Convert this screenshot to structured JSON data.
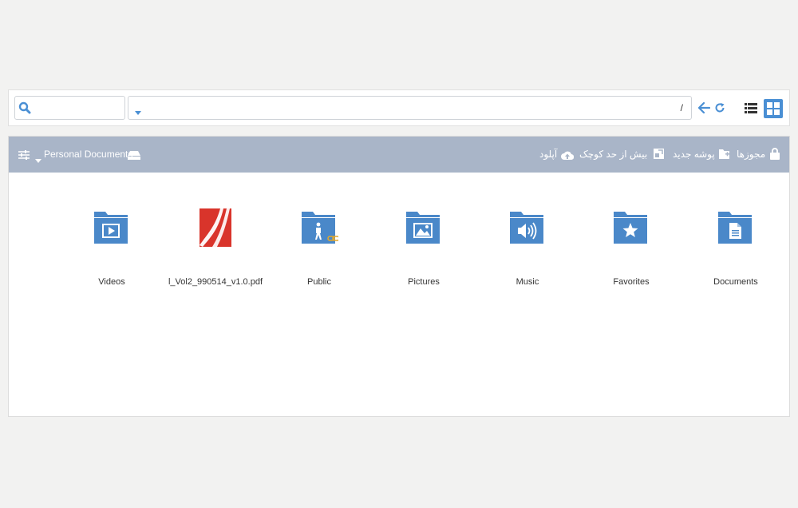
{
  "toolbar": {
    "search": {
      "value": "",
      "placeholder": ""
    },
    "path": "/",
    "icons": [
      "search-icon",
      "caret-down-icon",
      "back-arrow-icon",
      "refresh-icon",
      "list-view-icon",
      "grid-view-icon"
    ]
  },
  "header": {
    "location_label": "Personal Documents",
    "actions": {
      "permissions": "مجوزها",
      "new_folder": "پوشه جدید",
      "thumbnails": "بیش از حد کوچک",
      "upload": "آپلود"
    },
    "icons": [
      "lock-icon",
      "new-folder-icon",
      "thumbnail-icon",
      "upload-cloud-icon",
      "drive-icon",
      "caret-down-icon",
      "settings-sliders-icon"
    ]
  },
  "files": [
    {
      "name": "Videos",
      "icon": "folder-video-icon"
    },
    {
      "name": "l_Vol2_990514_v1.0.pdf",
      "icon": "pdf-file-icon"
    },
    {
      "name": "Public",
      "icon": "folder-public-icon"
    },
    {
      "name": "Pictures",
      "icon": "folder-pictures-icon"
    },
    {
      "name": "Music",
      "icon": "folder-music-icon"
    },
    {
      "name": "Favorites",
      "icon": "folder-favorites-icon"
    },
    {
      "name": "Documents",
      "icon": "folder-documents-icon"
    }
  ],
  "colors": {
    "accent": "#4a8fd4",
    "folder": "#4a88c9",
    "header_bg": "#a9b5c8",
    "pdf_red": "#d9342b",
    "link_gold": "#e5a92a"
  }
}
